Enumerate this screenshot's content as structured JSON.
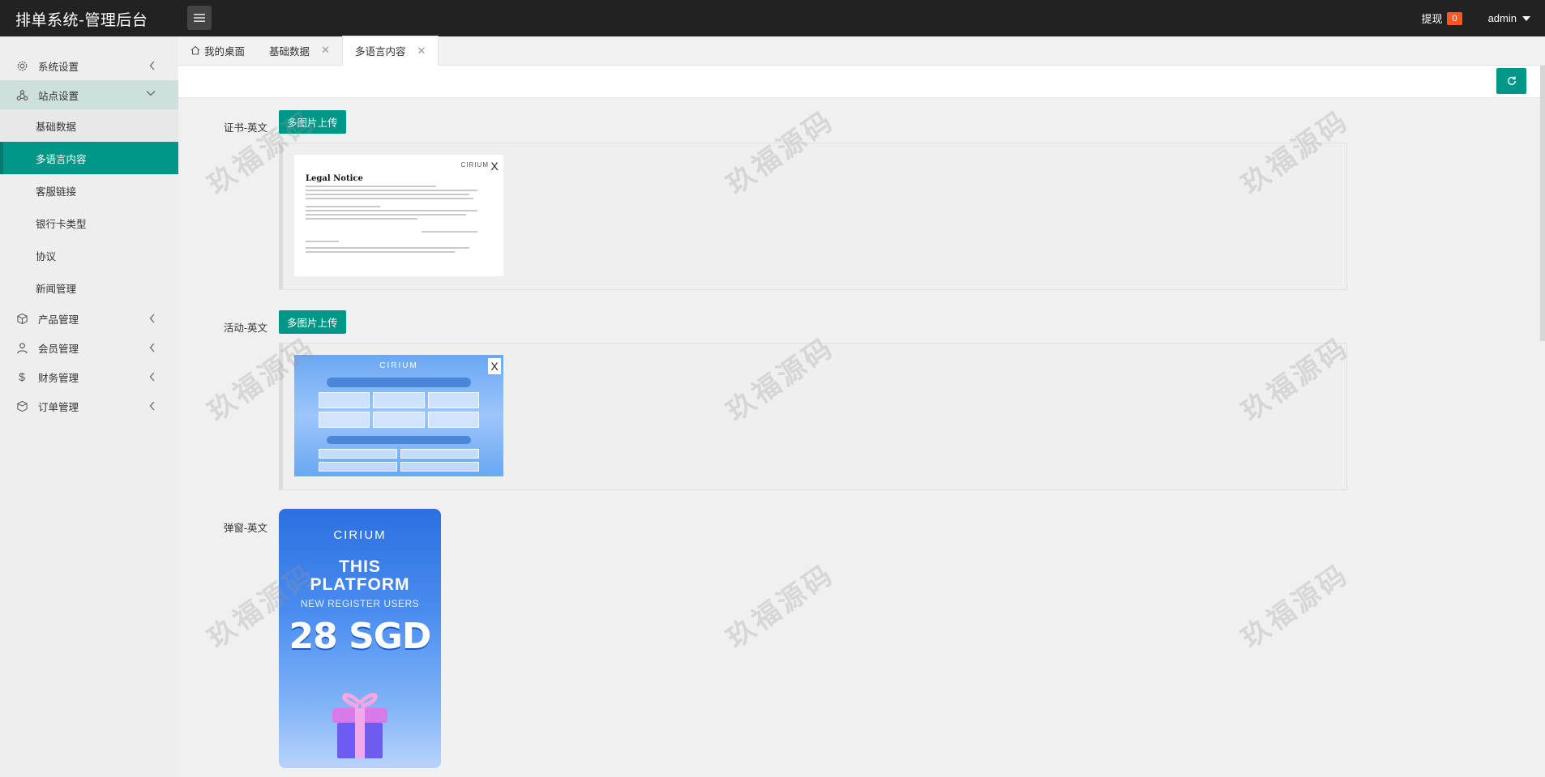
{
  "header": {
    "app_title": "排单系统-管理后台",
    "withdraw_label": "提现",
    "withdraw_count": "0",
    "user_name": "admin"
  },
  "sidebar": {
    "items": [
      {
        "label": "系统设置",
        "icon": "gear-icon"
      },
      {
        "label": "站点设置",
        "icon": "sitemap-icon"
      },
      {
        "label": "产品管理",
        "icon": "box-icon"
      },
      {
        "label": "会员管理",
        "icon": "user-icon"
      },
      {
        "label": "财务管理",
        "icon": "dollar-icon"
      },
      {
        "label": "订单管理",
        "icon": "order-icon"
      }
    ],
    "subitems": [
      "基础数据",
      "多语言内容",
      "客服链接",
      "银行卡类型",
      "协议",
      "新闻管理"
    ]
  },
  "tabs": [
    {
      "label": "我的桌面"
    },
    {
      "label": "基础数据"
    },
    {
      "label": "多语言内容"
    }
  ],
  "form": {
    "cert_label": "证书-英文",
    "activity_label": "活动-英文",
    "popup_label": "弹窗-英文",
    "upload_label": "多图片上传",
    "close_glyph": "X"
  },
  "images": {
    "cert": {
      "brand": "CIRIUM",
      "title": "Legal Notice"
    },
    "activity": {
      "brand": "CIRIUM"
    },
    "popup": {
      "brand": "CIRIUM",
      "line1": "THIS",
      "line2": "PLATFORM",
      "line3": "NEW REGISTER USERS",
      "amount": "28 SGD"
    }
  },
  "watermark": "玖福源码",
  "colors": {
    "accent": "#009688",
    "header_bg": "#222222",
    "badge": "#ff5722"
  }
}
